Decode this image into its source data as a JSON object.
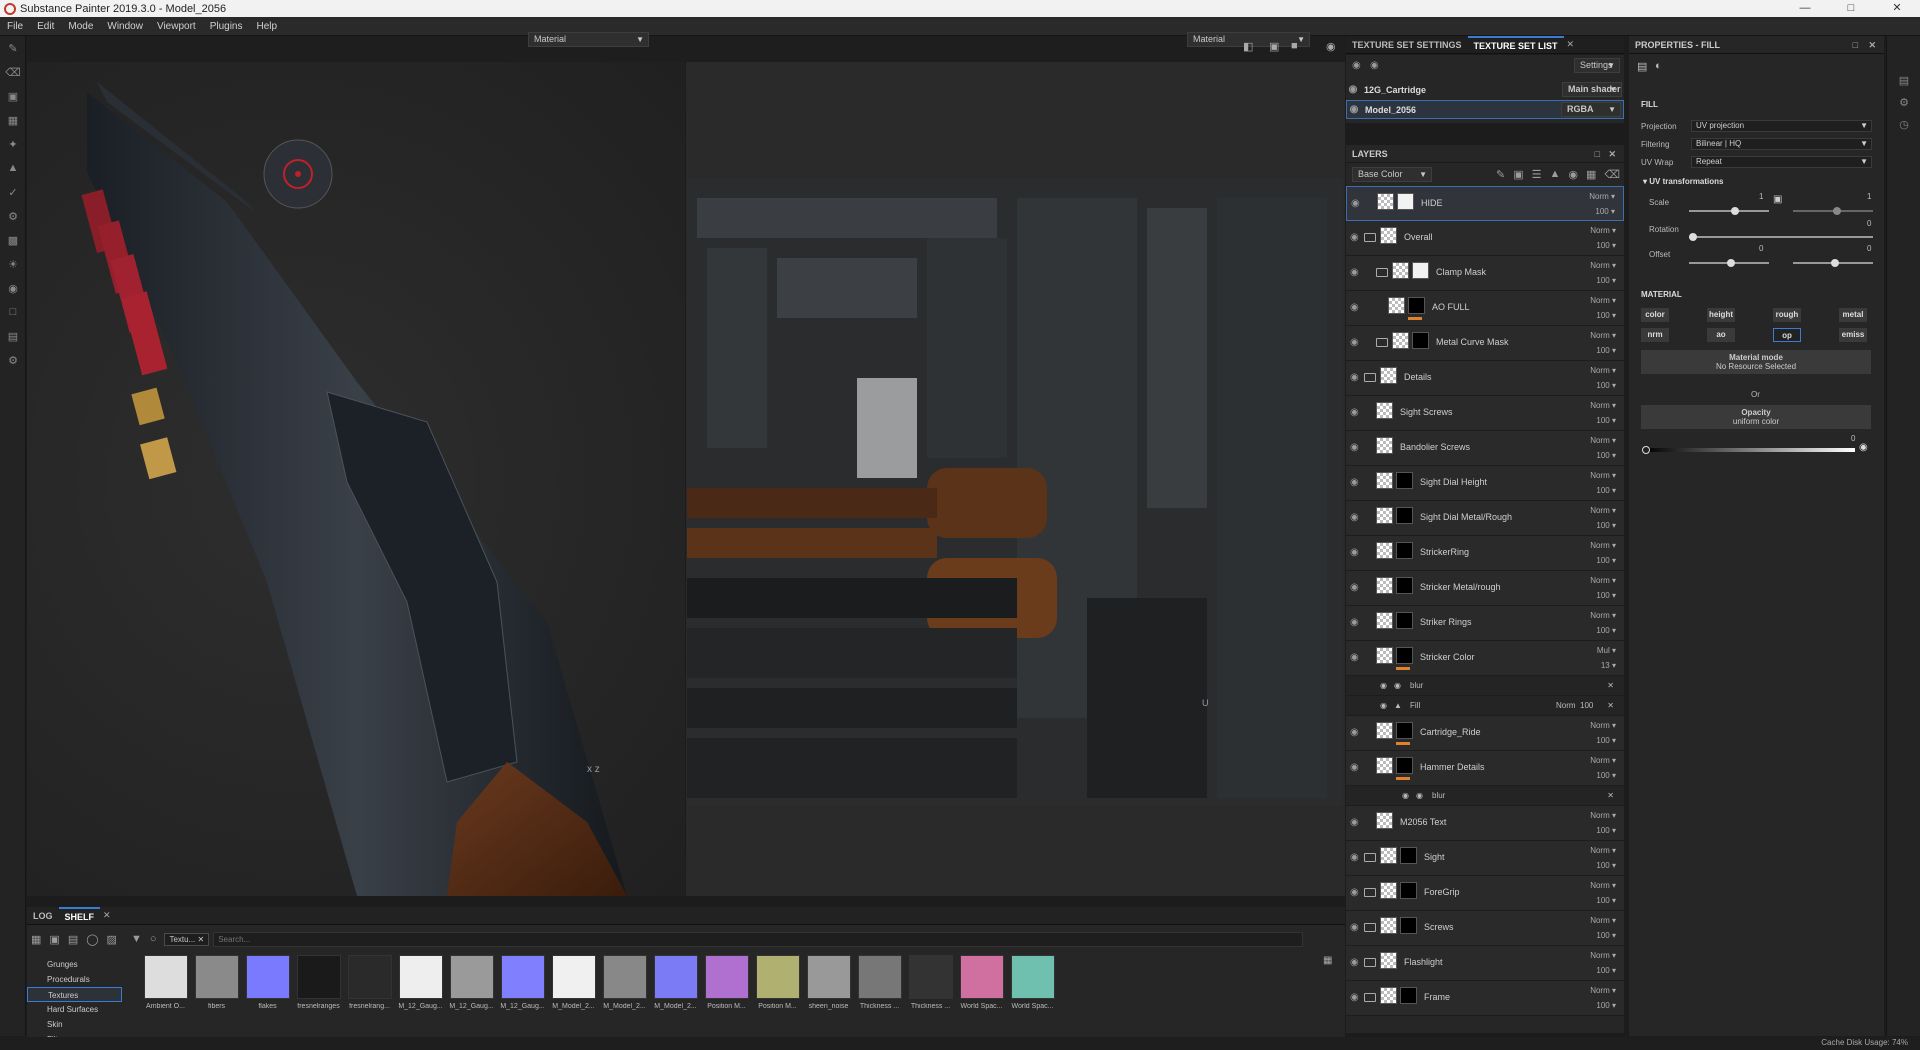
{
  "window": {
    "title": "Substance Painter 2019.3.0 - Model_2056"
  },
  "menu": [
    "File",
    "Edit",
    "Mode",
    "Window",
    "Viewport",
    "Plugins",
    "Help"
  ],
  "viewport": {
    "left_mode": "Material",
    "right_mode": "Material"
  },
  "texture_set": {
    "tabs": [
      "TEXTURE SET SETTINGS",
      "TEXTURE SET LIST"
    ],
    "settings_label": "Settings",
    "rows": [
      {
        "name": "12G_Cartridge",
        "shader": "Main shader"
      },
      {
        "name": "Model_2056",
        "shader": "RGBA"
      }
    ]
  },
  "layers": {
    "title": "LAYERS",
    "channel": "Base Color",
    "items": [
      {
        "name": "HIDE",
        "blend": "Norm",
        "opacity": "100"
      },
      {
        "name": "Overall",
        "blend": "Norm",
        "opacity": "100"
      },
      {
        "name": "Clamp Mask",
        "blend": "Norm",
        "opacity": "100"
      },
      {
        "name": "AO FULL",
        "blend": "Norm",
        "opacity": "100"
      },
      {
        "name": "Metal Curve Mask",
        "blend": "Norm",
        "opacity": "100"
      },
      {
        "name": "Details",
        "blend": "Norm",
        "opacity": "100"
      },
      {
        "name": "Sight Screws",
        "blend": "Norm",
        "opacity": "100"
      },
      {
        "name": "Bandolier Screws",
        "blend": "Norm",
        "opacity": "100"
      },
      {
        "name": "Sight Dial Height",
        "blend": "Norm",
        "opacity": "100"
      },
      {
        "name": "Sight Dial Metal/Rough",
        "blend": "Norm",
        "opacity": "100"
      },
      {
        "name": "StrickerRing",
        "blend": "Norm",
        "opacity": "100"
      },
      {
        "name": "Stricker Metal/rough",
        "blend": "Norm",
        "opacity": "100"
      },
      {
        "name": "Striker Rings",
        "blend": "Norm",
        "opacity": "100"
      },
      {
        "name": "Stricker Color",
        "blend": "Mul",
        "opacity": "13"
      },
      {
        "name": "Cartridge_Ride",
        "blend": "Norm",
        "opacity": "100"
      },
      {
        "name": "Hammer Details",
        "blend": "Norm",
        "opacity": "100"
      },
      {
        "name": "M2056 Text",
        "blend": "Norm",
        "opacity": "100"
      },
      {
        "name": "Sight",
        "blend": "Norm",
        "opacity": "100"
      },
      {
        "name": "ForeGrip",
        "blend": "Norm",
        "opacity": "100"
      },
      {
        "name": "Screws",
        "blend": "Norm",
        "opacity": "100"
      },
      {
        "name": "Flashlight",
        "blend": "Norm",
        "opacity": "100"
      },
      {
        "name": "Frame",
        "blend": "Norm",
        "opacity": "100"
      }
    ],
    "sub_blur": "blur",
    "sub_fill": "Fill",
    "sub_fill_blend": "Norm",
    "sub_fill_opacity": "100",
    "sub_blur2": "blur"
  },
  "properties": {
    "title": "PROPERTIES - FILL",
    "fill_label": "FILL",
    "projection_label": "Projection",
    "projection": "UV projection",
    "filtering_label": "Filtering",
    "filtering": "Bilinear | HQ",
    "uvwrap_label": "UV Wrap",
    "uvwrap": "Repeat",
    "uv_transformations": "UV transformations",
    "scale_label": "Scale",
    "scale_a": "1",
    "scale_b": "1",
    "rotation_label": "Rotation",
    "rotation": "0",
    "offset_label": "Offset",
    "offset_a": "0",
    "offset_b": "0",
    "material_label": "MATERIAL",
    "channels": [
      "color",
      "height",
      "rough",
      "metal",
      "nrm",
      "ao",
      "op",
      "emiss"
    ],
    "material_mode": "Material mode",
    "no_resource": "No Resource Selected",
    "or": "Or",
    "opacity": "Opacity",
    "uniform": "uniform color",
    "opacity_value": "0"
  },
  "shelf": {
    "tabs": [
      "LOG",
      "SHELF"
    ],
    "filter_chip": "Textu...",
    "search_placeholder": "Search...",
    "categories": [
      "Grunges",
      "Procedurals",
      "Textures",
      "Hard Surfaces",
      "Skin",
      "Filters"
    ],
    "assets": [
      {
        "label": "Ambient O...",
        "color": "#ddd"
      },
      {
        "label": "fibers",
        "color": "#8a8a8a"
      },
      {
        "label": "flakes",
        "color": "#7a7aff"
      },
      {
        "label": "fresnelranges",
        "color": "#1a1a1a"
      },
      {
        "label": "fresnelrang...",
        "color": "#2a2a2a"
      },
      {
        "label": "M_12_Gaug...",
        "color": "#eeeeee"
      },
      {
        "label": "M_12_Gaug...",
        "color": "#9a9a9a"
      },
      {
        "label": "M_12_Gaug...",
        "color": "#8080ff"
      },
      {
        "label": "M_Model_2...",
        "color": "#f0f0f0"
      },
      {
        "label": "M_Model_2...",
        "color": "#888888"
      },
      {
        "label": "M_Model_2...",
        "color": "#7b7bf5"
      },
      {
        "label": "Position M...",
        "color": "#b070d0"
      },
      {
        "label": "Position M...",
        "color": "#b0b070"
      },
      {
        "label": "sheen_noise",
        "color": "#999"
      },
      {
        "label": "Thickness ...",
        "color": "#777"
      },
      {
        "label": "Thickness ...",
        "color": "#333"
      },
      {
        "label": "World Spac...",
        "color": "#d070a0"
      },
      {
        "label": "World Spac...",
        "color": "#70c0b0"
      }
    ]
  },
  "status": {
    "cache": "Cache Disk Usage:",
    "cache_value": "74%"
  }
}
